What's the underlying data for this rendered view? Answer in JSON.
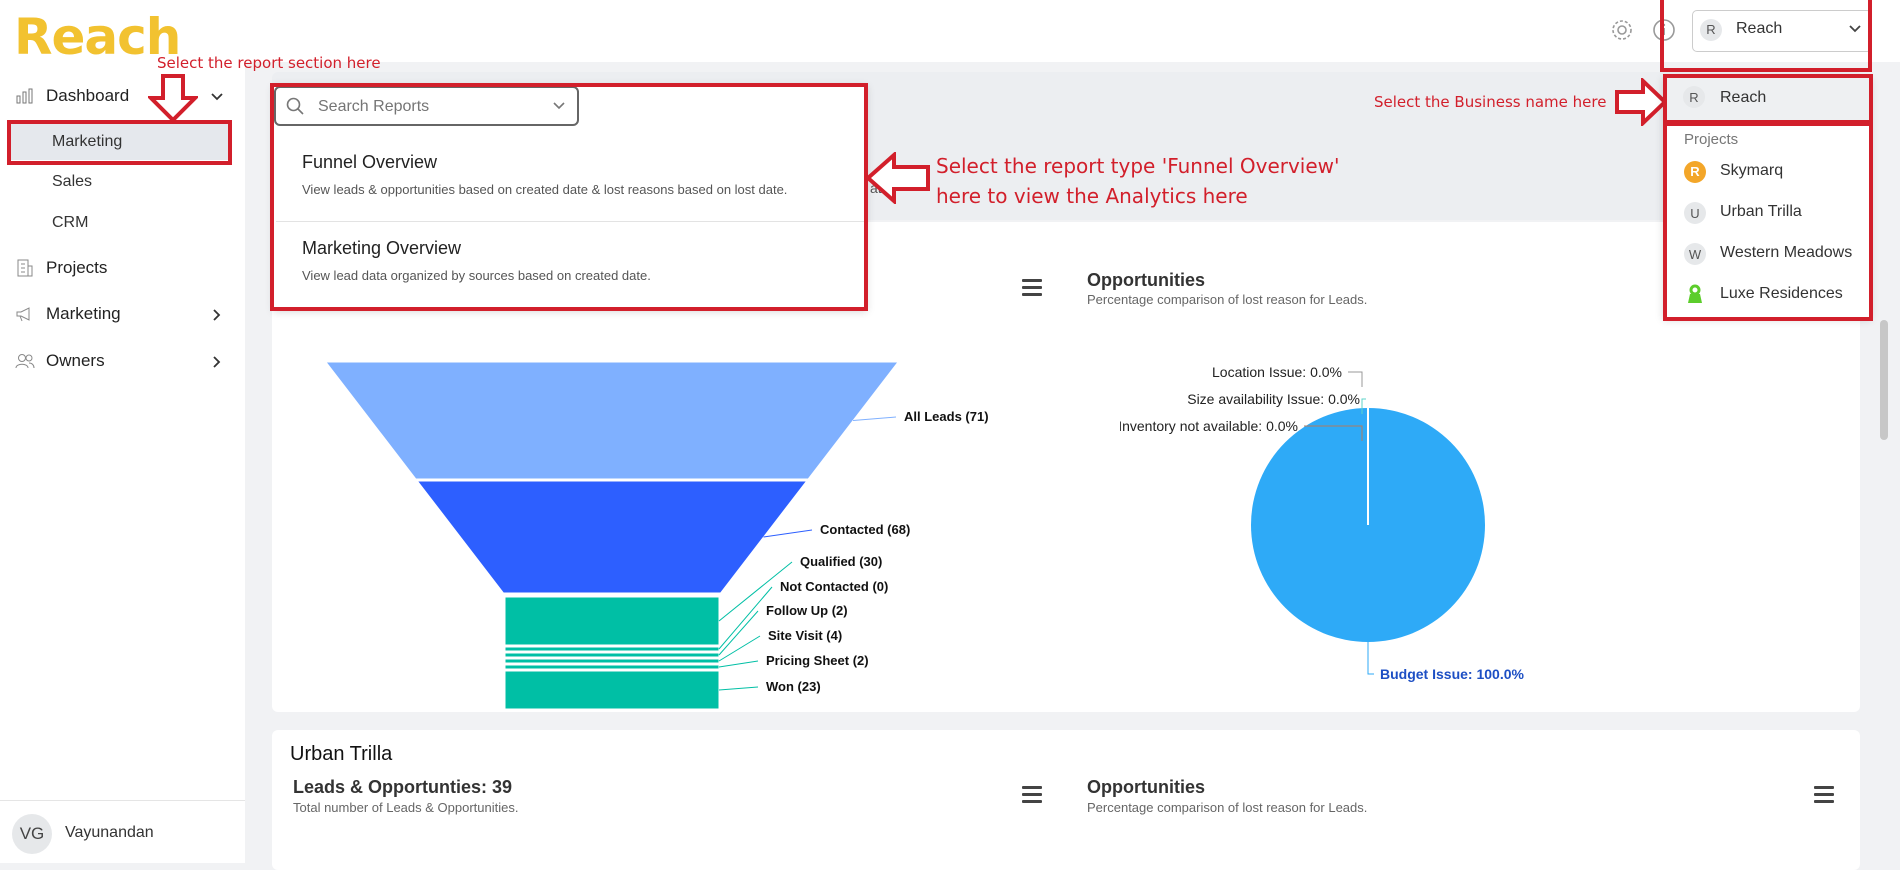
{
  "app": {
    "logo": "Reach"
  },
  "header": {
    "business_selector": "Reach",
    "business_avatar": "R"
  },
  "sidebar": {
    "dashboard_label": "Dashboard",
    "sub_items": [
      "Marketing",
      "Sales",
      "CRM"
    ],
    "projects_label": "Projects",
    "marketing_label": "Marketing",
    "owners_label": "Owners",
    "user": {
      "initials": "VG",
      "name": "Vayunandan"
    }
  },
  "search": {
    "placeholder": "Search Reports",
    "options": [
      {
        "title": "Funnel Overview",
        "desc": "View leads & opportunities based on created date & lost reasons based on lost date."
      },
      {
        "title": "Marketing Overview",
        "desc": "View lead data organized by sources based on created date."
      }
    ],
    "behind_text": "ate"
  },
  "annotations": {
    "report_section": "Select the report section here",
    "business_name": "Select the Business name here",
    "report_type_line1": "Select the report type 'Funnel Overview'",
    "report_type_line2": "here to view the Analytics here"
  },
  "business_dropdown": {
    "selected": {
      "avatar": "R",
      "name": "Reach"
    },
    "projects_heading": "Projects",
    "projects": [
      {
        "avatar": "R",
        "name": "Skymarq",
        "icon": "skymarq-logo-icon"
      },
      {
        "avatar": "U",
        "name": "Urban Trilla",
        "icon": "letter-avatar"
      },
      {
        "avatar": "W",
        "name": "Western Meadows",
        "icon": "letter-avatar"
      },
      {
        "avatar": "",
        "name": "Luxe Residences",
        "icon": "luxe-logo-icon"
      }
    ]
  },
  "opportunities_card": {
    "title": "Opportunities",
    "subtitle": "Percentage comparison of lost reason for Leads."
  },
  "chart_data": [
    {
      "type": "funnel",
      "categories": [
        "All Leads",
        "Contacted",
        "Qualified",
        "Not Contacted",
        "Follow Up",
        "Site Visit",
        "Pricing Sheet",
        "Won"
      ],
      "values": [
        71,
        68,
        30,
        0,
        2,
        4,
        2,
        23
      ],
      "labels": [
        "All Leads (71)",
        "Contacted (68)",
        "Qualified (30)",
        "Not Contacted (0)",
        "Follow Up (2)",
        "Site Visit (4)",
        "Pricing Sheet (2)",
        "Won (23)"
      ],
      "colors": [
        "#7fb0ff",
        "#2d5fff",
        "#00bfa5",
        "#00bfa5",
        "#00bfa5",
        "#00bfa5",
        "#00bfa5",
        "#00bfa5"
      ]
    },
    {
      "type": "pie",
      "categories": [
        "Location Issue",
        "Size availability Issue",
        "Inventory not available",
        "Budget Issue"
      ],
      "values": [
        0.0,
        0.0,
        0.0,
        100.0
      ],
      "labels": [
        "Location Issue: 0.0%",
        "Size availability Issue: 0.0%",
        "Inventory not available: 0.0%",
        "Budget Issue: 100.0%"
      ],
      "colors": [
        "#999999",
        "#5dd3c8",
        "#b07c60",
        "#2eaaf7"
      ]
    }
  ],
  "section2": {
    "title": "Urban Trilla",
    "leads_title": "Leads & Opportunties: 39",
    "leads_sub": "Total number of Leads & Opportunities.",
    "opp_title": "Opportunities",
    "opp_sub": "Percentage comparison of lost reason for Leads."
  }
}
